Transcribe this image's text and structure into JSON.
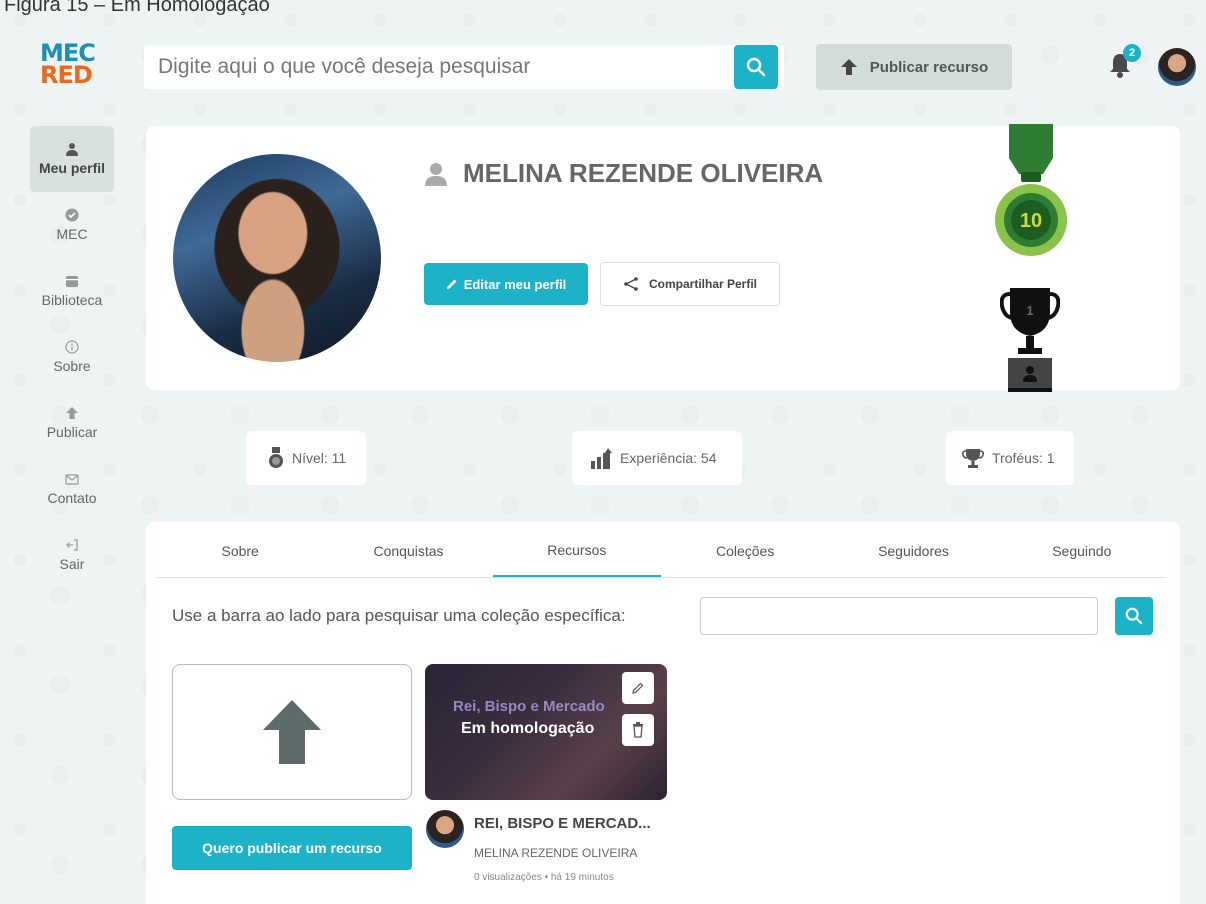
{
  "caption": "Figura 15 – Em Homologação",
  "header": {
    "logo_line1": "MEC",
    "logo_line2": "RED",
    "search_placeholder": "Digite aqui o que você deseja pesquisar",
    "publish_label": "Publicar recurso",
    "notification_count": "2"
  },
  "sidebar": {
    "items": [
      {
        "label": "Meu perfil",
        "icon": "user-icon"
      },
      {
        "label": "MEC",
        "icon": "check-circle-icon"
      },
      {
        "label": "Biblioteca",
        "icon": "library-icon"
      },
      {
        "label": "Sobre",
        "icon": "info-icon"
      },
      {
        "label": "Publicar",
        "icon": "upload-arrow-icon"
      },
      {
        "label": "Contato",
        "icon": "mail-icon"
      },
      {
        "label": "Sair",
        "icon": "logout-icon"
      }
    ]
  },
  "profile": {
    "name": "MELINA REZENDE OLIVEIRA",
    "edit_label": "Editar meu perfil",
    "share_label": "Compartilhar Perfil",
    "medal_level": "10",
    "trophy_rank": "1"
  },
  "stats": {
    "level": "Nível: 11",
    "experience": "Experiência: 54",
    "trophies": "Troféus: 1"
  },
  "tabs": [
    "Sobre",
    "Conquistas",
    "Recursos",
    "Coleções",
    "Seguidores",
    "Seguindo"
  ],
  "active_tab": "Recursos",
  "collection_search": {
    "label": "Use a barra ao lado para pesquisar uma coleção específica:",
    "value": ""
  },
  "upload": {
    "button_label": "Quero publicar um recurso"
  },
  "resource": {
    "thumb_title": "Rei, Bispo e Mercado",
    "status": "Em homologação",
    "title": "REI, BISPO E MERCAD...",
    "author": "MELINA REZENDE OLIVEIRA",
    "meta": "0 visualizações • há 19 minutos"
  },
  "colors": {
    "accent": "#1cb3c9",
    "background": "#eef4f4",
    "medal_green": "#2e8b3a",
    "logo_blue": "#1e8fb4",
    "logo_orange": "#e86a1e"
  }
}
